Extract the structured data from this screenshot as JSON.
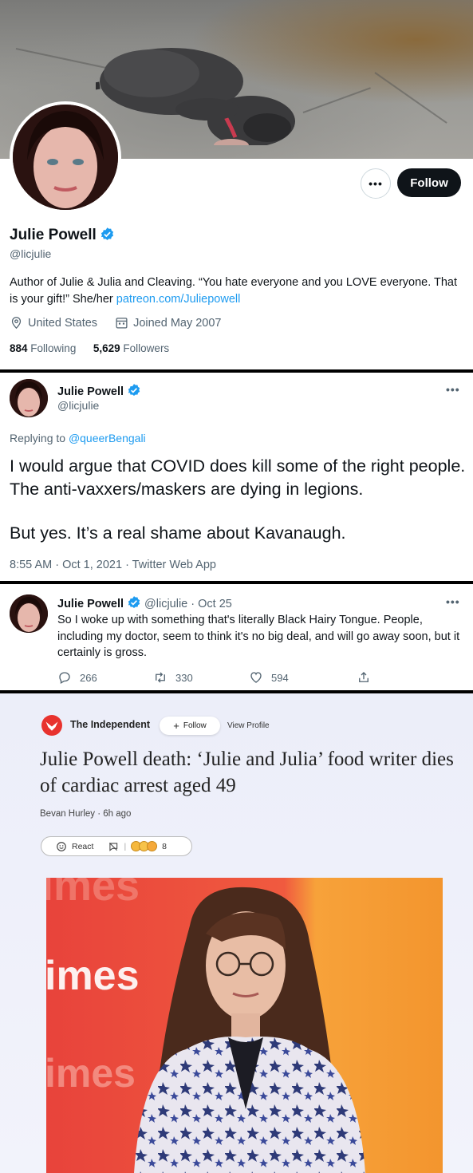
{
  "profile": {
    "follow_label": "Follow",
    "more_label": "•••",
    "name": "Julie Powell",
    "handle": "@licjulie",
    "bio_text": "Author of Julie & Julia and Cleaving. “You hate everyone and you LOVE everyone. That is your gift!” She/her ",
    "bio_link": "patreon.com/Juliepowell",
    "location": "United States",
    "joined": "Joined May 2007",
    "following_count": "884",
    "following_label": "Following",
    "followers_count": "5,629",
    "followers_label": "Followers"
  },
  "tweet1": {
    "name": "Julie Powell",
    "handle": "@licjulie",
    "more_label": "•••",
    "replying_prefix": "Replying to ",
    "replying_to": "@queerBengali",
    "paragraph1": "I would argue that COVID does kill some of the right people. The anti-vaxxers/maskers are dying in legions.",
    "paragraph2": "But yes. It’s a real shame about Kavanaugh.",
    "timestamp": "8:55 AM · Oct 1, 2021 · Twitter Web App"
  },
  "tweet2": {
    "name": "Julie Powell",
    "handle": "@licjulie",
    "date": "· Oct 25",
    "more_label": "•••",
    "text": "So I woke up with something that's literally Black Hairy Tongue. People, including my doctor, seem to think it's no big deal, and will go away soon, but it certainly is gross.",
    "replies": "266",
    "retweets": "330",
    "likes": "594"
  },
  "article": {
    "publisher": "The Independent",
    "follow_label": "Follow",
    "view_profile_label": "View Profile",
    "title": "Julie Powell death: ‘Julie and Julia’ food writer dies of cardiac arrest aged 49",
    "author_line": "Bevan Hurley · 6h ago",
    "react_label": "React",
    "reaction_count": "8",
    "backdrop_text": "imes"
  },
  "colors": {
    "twitter_blue": "#1d9bf0",
    "follow_button": "#0f1419",
    "independent_red": "#e8322e"
  }
}
